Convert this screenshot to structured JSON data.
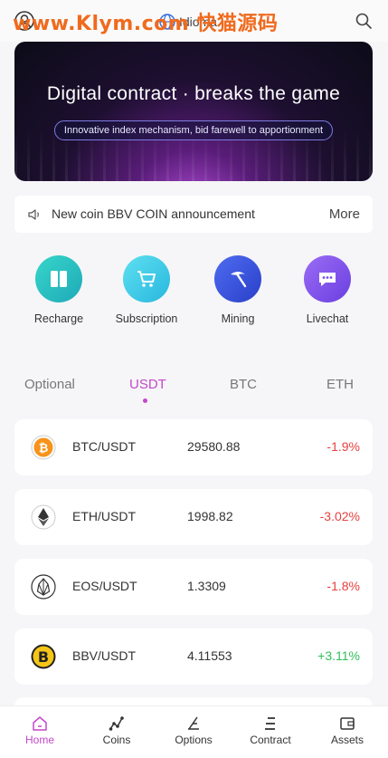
{
  "header": {
    "watermark": "www.Klym.com 快猫源码",
    "language_label": "Idioma",
    "icons": [
      "user-icon",
      "globe-icon",
      "search-icon"
    ]
  },
  "banner": {
    "title": "Digital contract · breaks the game",
    "subtitle": "Innovative index mechanism, bid farewell to apportionment"
  },
  "notice": {
    "icon": "speaker-icon",
    "text": "New coin BBV COIN announcement",
    "more_label": "More"
  },
  "shortcuts": [
    {
      "label": "Recharge",
      "icon": "book-icon",
      "color": "#2ec5c5"
    },
    {
      "label": "Subscription",
      "icon": "cart-icon",
      "color": "#38c9e6"
    },
    {
      "label": "Mining",
      "icon": "pickaxe-icon",
      "color": "#3b55e0"
    },
    {
      "label": "Livechat",
      "icon": "chat-icon",
      "color": "#7a4df0"
    }
  ],
  "tabs": [
    {
      "label": "Optional",
      "active": false
    },
    {
      "label": "USDT",
      "active": true
    },
    {
      "label": "BTC",
      "active": false
    },
    {
      "label": "ETH",
      "active": false
    }
  ],
  "markets": [
    {
      "pair": "BTC/USDT",
      "price": "29580.88",
      "change": "-1.9%",
      "trend": "down",
      "icon": "bitcoin-icon"
    },
    {
      "pair": "ETH/USDT",
      "price": "1998.82",
      "change": "-3.02%",
      "trend": "down",
      "icon": "ethereum-icon"
    },
    {
      "pair": "EOS/USDT",
      "price": "1.3309",
      "change": "-1.8%",
      "trend": "down",
      "icon": "eos-icon"
    },
    {
      "pair": "BBV/USDT",
      "price": "4.11553",
      "change": "+3.11%",
      "trend": "up",
      "icon": "bbv-icon"
    }
  ],
  "bottom_nav": [
    {
      "label": "Home",
      "icon": "home-icon",
      "active": true
    },
    {
      "label": "Coins",
      "icon": "coins-icon",
      "active": false
    },
    {
      "label": "Options",
      "icon": "options-icon",
      "active": false
    },
    {
      "label": "Contract",
      "icon": "contract-icon",
      "active": false
    },
    {
      "label": "Assets",
      "icon": "wallet-icon",
      "active": false
    }
  ],
  "colors": {
    "accent": "#c448c9",
    "negative": "#e8413e",
    "positive": "#2fbf5a"
  }
}
